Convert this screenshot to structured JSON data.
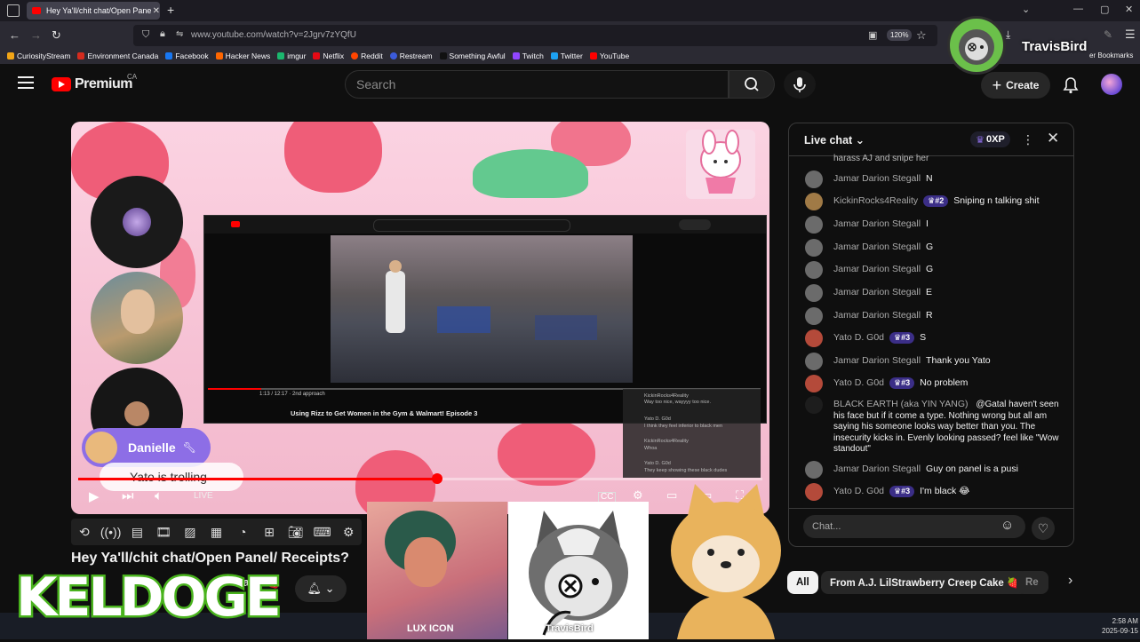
{
  "browser": {
    "tab_title": "Hey Ya'll/chit chat/Open Panel/ Receipts?",
    "url": "www.youtube.com/watch?v=2Jgrv7zYQfU",
    "zoom": "120%",
    "bookmarks": [
      {
        "label": "CuriosityStream",
        "color": "#f2a516"
      },
      {
        "label": "Environment Canada",
        "color": "#d52b1e"
      },
      {
        "label": "Facebook",
        "color": "#1877f2"
      },
      {
        "label": "Hacker News",
        "color": "#ff6600"
      },
      {
        "label": "imgur",
        "color": "#1bb76e"
      },
      {
        "label": "Netflix",
        "color": "#e50914"
      },
      {
        "label": "Reddit",
        "color": "#ff4500"
      },
      {
        "label": "Restream",
        "color": "#3b5bdb"
      },
      {
        "label": "Something Awful",
        "color": "#222222"
      },
      {
        "label": "Twitch",
        "color": "#9146ff"
      },
      {
        "label": "Twitter",
        "color": "#1da1f2"
      },
      {
        "label": "YouTube",
        "color": "#ff0000"
      }
    ],
    "other_bookmarks": "er Bookmarks"
  },
  "youtube": {
    "logo_text": "Premium",
    "region": "CA",
    "search_placeholder": "Search",
    "create_label": "Create"
  },
  "overlay": {
    "streamer_name": "TravisBird",
    "keldoge": "KELDOGE",
    "lux_label": "LUX ICON",
    "travis_label": "TravisBird"
  },
  "video": {
    "title": "Hey Ya'll/chit chat/Open Panel/ Receipts?",
    "partial_text": "Cake 🍓",
    "danielle_name": "Danielle",
    "bubble_text": "Yato is trolling",
    "live_label": "LIVE",
    "nested_video_title": "Using Rizz to Get Women in the Gym & Walmart! Episode 3",
    "nested_time": "1:13 / 12:17 · 2nd approach",
    "progress_percent": 52
  },
  "chat": {
    "title": "Live chat",
    "xp": "0XP",
    "partial_top": "harass AJ and snipe her",
    "messages": [
      {
        "author": "Jamar Darion Stegall",
        "badge": "",
        "text": "N",
        "avatar": "#6b6b6b"
      },
      {
        "author": "KickinRocks4Reality",
        "badge": "#2",
        "text": "Sniping n talking shit",
        "avatar": "#a07a46"
      },
      {
        "author": "Jamar Darion Stegall",
        "badge": "",
        "text": "I",
        "avatar": "#6b6b6b"
      },
      {
        "author": "Jamar Darion Stegall",
        "badge": "",
        "text": "G",
        "avatar": "#6b6b6b"
      },
      {
        "author": "Jamar Darion Stegall",
        "badge": "",
        "text": "G",
        "avatar": "#6b6b6b"
      },
      {
        "author": "Jamar Darion Stegall",
        "badge": "",
        "text": "E",
        "avatar": "#6b6b6b"
      },
      {
        "author": "Jamar Darion Stegall",
        "badge": "",
        "text": "R",
        "avatar": "#6b6b6b"
      },
      {
        "author": "Yato D. G0d",
        "badge": "#3",
        "text": "S",
        "avatar": "#b44a3a"
      },
      {
        "author": "Jamar Darion Stegall",
        "badge": "",
        "text": "Thank you Yato",
        "avatar": "#6b6b6b"
      },
      {
        "author": "Yato D. G0d",
        "badge": "#3",
        "text": "No problem",
        "avatar": "#b44a3a"
      },
      {
        "author": "BLACK EARTH (aka YIN YANG)",
        "badge": "",
        "text": "@Gatal haven't seen his face but if it come a type. Nothing wrong but all am saying his someone looks way better than you. The insecurity kicks in. Evenly looking passed? feel like \"Wow standout\"",
        "avatar": "#1d1d1d"
      },
      {
        "author": "Jamar Darion Stegall",
        "badge": "",
        "text": "Guy on panel is a pusi",
        "avatar": "#6b6b6b"
      },
      {
        "author": "Yato D. G0d",
        "badge": "#3",
        "text": "I'm black 😂",
        "avatar": "#b44a3a"
      }
    ],
    "input_placeholder": "Chat...",
    "chips": [
      "All",
      "From A.J. LilStrawberry Creep Cake 🍓",
      "Re"
    ]
  },
  "taskbar": {
    "time": "2:58 AM",
    "date": "2025-09-15"
  },
  "colors": {
    "accent_red": "#ff0000",
    "badge_purple": "#3b2e87"
  }
}
